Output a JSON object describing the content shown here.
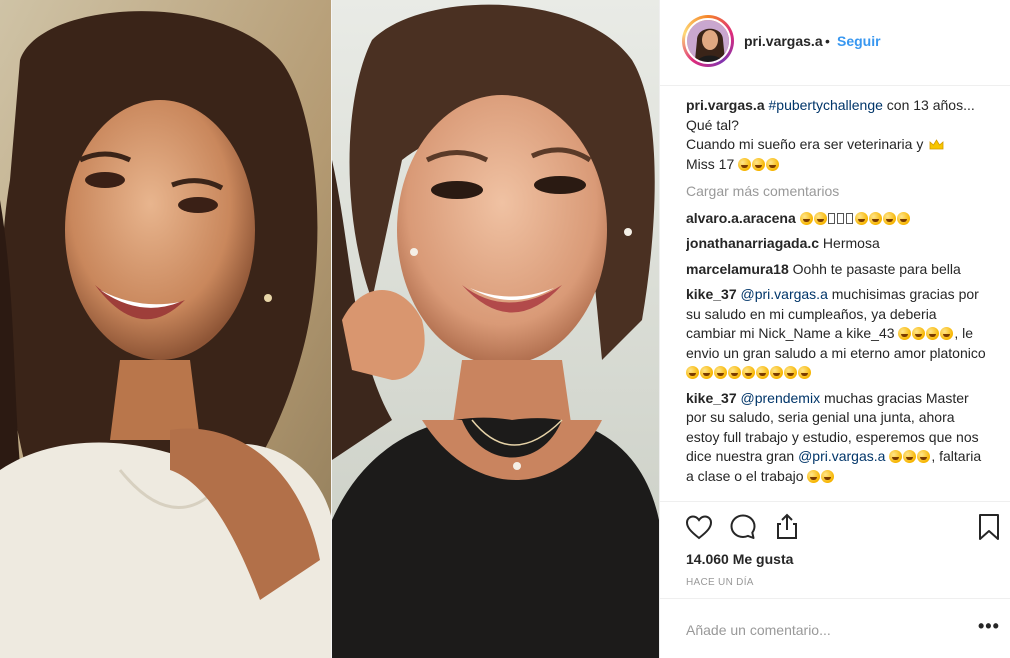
{
  "post": {
    "username": "pri.vargas.a",
    "separator": "•",
    "follow_label": "Seguir",
    "caption": {
      "username": "pri.vargas.a",
      "hashtag": "#pubertychallenge",
      "text_a": " con 13 años... Qué tal?",
      "text_b": "Cuando mi sueño era ser veterinaria y ",
      "text_c": "Miss 17 "
    },
    "load_more_label": "Cargar más comentarios",
    "comments": [
      {
        "username": "alvaro.a.aracena",
        "text": ""
      },
      {
        "username": "jonathanarriagada.c",
        "text": " Hermosa"
      },
      {
        "username": "marcelamura18",
        "text": " Oohh te pasaste para bella"
      },
      {
        "username": "kike_37",
        "mention": "@pri.vargas.a",
        "text": " muchisimas gracias por su saludo en mi cumpleaños, ya deberia cambiar mi Nick_Name a kike_43 ",
        "text2": ", le envio un gran saludo a mi eterno amor platonico "
      },
      {
        "username": "kike_37",
        "mention": "@prendemix",
        "text": " muchas gracias Master por su saludo, seria genial una junta, ahora estoy full trabajo y estudio, esperemos que nos dice nuestra gran ",
        "mention2": "@pri.vargas.a",
        "text2": ", faltaria a clase o el trabajo "
      }
    ],
    "likes": "14.060 Me gusta",
    "time_ago": "HACE UN DÍA",
    "add_comment_placeholder": "Añade un comentario...",
    "more_label": "•••"
  },
  "icons": {
    "like": "heart-icon",
    "comment": "comment-bubble-icon",
    "share": "share-icon",
    "save": "bookmark-icon",
    "more": "more-options-icon"
  },
  "colors": {
    "link_blue": "#3897f0",
    "mention_blue": "#003569",
    "muted": "#999999",
    "border": "#efefef",
    "text": "#262626"
  }
}
